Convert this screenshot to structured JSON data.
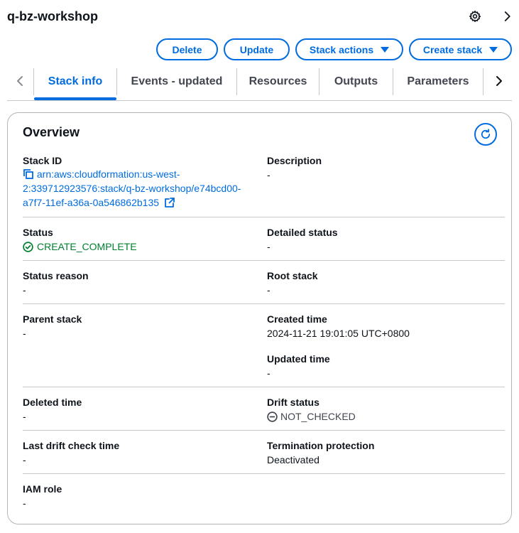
{
  "header": {
    "title": "q-bz-workshop"
  },
  "actions": {
    "delete": "Delete",
    "update": "Update",
    "stack_actions": "Stack actions",
    "create_stack": "Create stack"
  },
  "tabs": [
    {
      "label": "Stack info",
      "active": true
    },
    {
      "label": "Events - updated",
      "active": false
    },
    {
      "label": "Resources",
      "active": false
    },
    {
      "label": "Outputs",
      "active": false
    },
    {
      "label": "Parameters",
      "active": false
    }
  ],
  "overview": {
    "title": "Overview",
    "stack_id_label": "Stack ID",
    "stack_id_lines": [
      "arn:aws:cloudformation:us-west-",
      "2:339712923576:stack/q-bz-workshop/e74bcd00-",
      "a7f7-11ef-a36a-0a546862b135"
    ],
    "description_label": "Description",
    "description_value": "-",
    "status_label": "Status",
    "status_value": "CREATE_COMPLETE",
    "detailed_status_label": "Detailed status",
    "detailed_status_value": "-",
    "status_reason_label": "Status reason",
    "status_reason_value": "-",
    "root_stack_label": "Root stack",
    "root_stack_value": "-",
    "parent_stack_label": "Parent stack",
    "parent_stack_value": "-",
    "created_time_label": "Created time",
    "created_time_value": "2024-11-21 19:01:05 UTC+0800",
    "updated_time_label": "Updated time",
    "updated_time_value": "-",
    "deleted_time_label": "Deleted time",
    "deleted_time_value": "-",
    "drift_status_label": "Drift status",
    "drift_status_value": "NOT_CHECKED",
    "last_drift_label": "Last drift check time",
    "last_drift_value": "-",
    "termination_label": "Termination protection",
    "termination_value": "Deactivated",
    "iam_role_label": "IAM role",
    "iam_role_value": "-"
  },
  "colors": {
    "accent": "#006ce0",
    "success": "#00802f",
    "text": "#0f141a",
    "border": "#c6c6cd"
  },
  "icons": [
    "settings-gear-icon",
    "chevron-right-icon",
    "caret-down-icon",
    "chevron-left-icon",
    "refresh-icon",
    "copy-icon",
    "external-link-icon",
    "status-success-icon",
    "status-stopped-icon"
  ]
}
